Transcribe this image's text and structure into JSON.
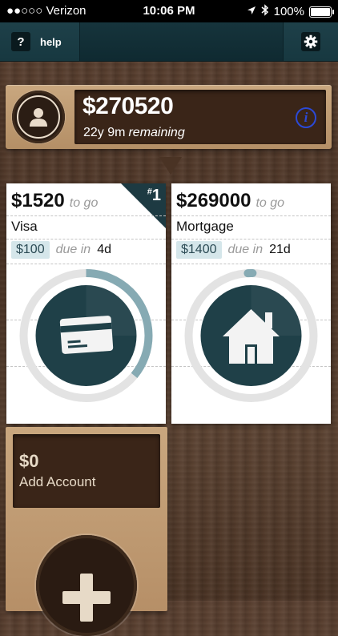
{
  "status_bar": {
    "carrier": "●●○○○ Verizon",
    "time": "10:06 PM",
    "battery": "100%"
  },
  "nav": {
    "help_icon": "?",
    "help_label": "help"
  },
  "summary": {
    "amount": "$270520",
    "time_remaining": "22y 9m",
    "remaining_label": "remaining",
    "info_icon": "i"
  },
  "cards": [
    {
      "amount": "$1520",
      "togo_label": "to go",
      "name": "Visa",
      "payment": "$100",
      "due_label": "due in",
      "due_value": "4d",
      "rank_hash": "#",
      "rank": "1",
      "icon": "credit-card-icon",
      "progress": 0.36
    },
    {
      "amount": "$269000",
      "togo_label": "to go",
      "name": "Mortgage",
      "payment": "$1400",
      "due_label": "due in",
      "due_value": "21d",
      "icon": "house-icon",
      "progress": 0.01
    }
  ],
  "add_account": {
    "amount": "$0",
    "label": "Add Account"
  },
  "colors": {
    "ring_bg": "#e3e3e3",
    "ring_progress": "#86aab3",
    "icon_disk": "#1f4048",
    "nav_bg": "#16343c"
  }
}
